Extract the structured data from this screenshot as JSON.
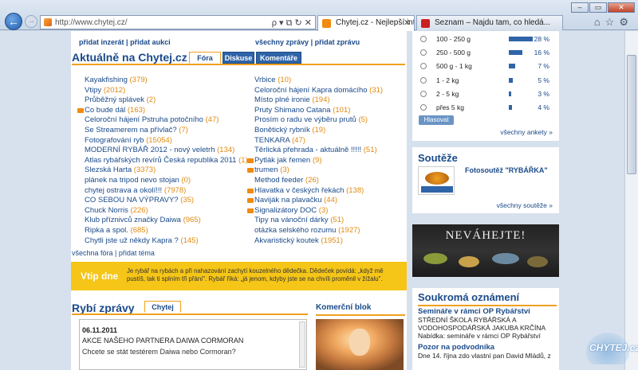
{
  "browser": {
    "url": "http://www.chytej.cz/",
    "tabs": [
      {
        "label": "Chytej.cz - Nejlepší internet...",
        "active": true,
        "icon_color": "#f08a10"
      },
      {
        "label": "Seznam – Najdu tam, co hledá...",
        "active": false,
        "icon_color": "#cc1e1e"
      }
    ],
    "addr_tools": "ρ ▾ ⧉ ↻ ✕",
    "window_buttons": {
      "min": "–",
      "max": "▭",
      "close": "✕"
    },
    "right_tools": "⌂☆⚙"
  },
  "header": {
    "add_ad": "přidat inzerát",
    "add_auction": "přidat aukci",
    "all_news": "všechny zprávy",
    "add_news": "přidat zprávu",
    "separator": "|"
  },
  "aktualne": {
    "title": "Aktuálně na Chytej.cz",
    "tabs": [
      "Fóra",
      "Diskuse",
      "Komentáře"
    ]
  },
  "forums_left": [
    {
      "name": "Kayakfishing",
      "count": "(379)",
      "new": false
    },
    {
      "name": "Vtipy",
      "count": "(2012)",
      "new": false
    },
    {
      "name": "Průběžný splávek",
      "count": "(2)",
      "new": false
    },
    {
      "name": "Co bude dál",
      "count": "(163)",
      "new": true
    },
    {
      "name": "Celoroční hájení Pstruha potočního",
      "count": "(47)",
      "new": false
    },
    {
      "name": "Se Streamerem na přívlač?",
      "count": "(7)",
      "new": false
    },
    {
      "name": "Fotografování ryb",
      "count": "(15054)",
      "new": false
    },
    {
      "name": "MODERNÍ RYBÁŘ 2012 - nový veletrh",
      "count": "(134)",
      "new": false
    },
    {
      "name": "Atlas rybářských revírů Česká republika 2011",
      "count": "(1)",
      "new": false
    },
    {
      "name": "Slezská Harta",
      "count": "(3373)",
      "new": false
    },
    {
      "name": "plánek na tripod nevo stojan",
      "count": "(0)",
      "new": false
    },
    {
      "name": "chytej ostrava a okolí!!!",
      "count": "(7978)",
      "new": false
    },
    {
      "name": "CO SEBOU NA VÝPRAVY?",
      "count": "(35)",
      "new": false
    },
    {
      "name": "Chuck Norris",
      "count": "(226)",
      "new": false
    },
    {
      "name": "Klub příznivců značky Daiwa",
      "count": "(965)",
      "new": false
    },
    {
      "name": "Ripka a spol.",
      "count": "(685)",
      "new": false
    },
    {
      "name": "Chytli jste už někdy Kapra ?",
      "count": "(145)",
      "new": false
    }
  ],
  "forums_right": [
    {
      "name": "Vrbice",
      "count": "(10)",
      "new": false
    },
    {
      "name": "Celoroční hájení Kapra domácího",
      "count": "(31)",
      "new": false
    },
    {
      "name": "Místo plné ironie",
      "count": "(194)",
      "new": false
    },
    {
      "name": "Pruty Shimano Catana",
      "count": "(101)",
      "new": false
    },
    {
      "name": "Prosím o radu ve výběru prutů",
      "count": "(5)",
      "new": false
    },
    {
      "name": "Bonětický rybník",
      "count": "(19)",
      "new": false
    },
    {
      "name": "TENKARA",
      "count": "(47)",
      "new": false
    },
    {
      "name": "Těrlická přehrada - aktuálně !!!!!",
      "count": "(51)",
      "new": false
    },
    {
      "name": "Pytlák jak řemen",
      "count": "(9)",
      "new": true
    },
    {
      "name": "trumen",
      "count": "(3)",
      "new": true
    },
    {
      "name": "Method feeder",
      "count": "(26)",
      "new": false
    },
    {
      "name": "Hlavatka v českých řekách",
      "count": "(138)",
      "new": true
    },
    {
      "name": "Naviják na plavačku",
      "count": "(44)",
      "new": true
    },
    {
      "name": "Signalizátory DOC",
      "count": "(3)",
      "new": true
    },
    {
      "name": "Tipy na vánoční dárky",
      "count": "(51)",
      "new": false
    },
    {
      "name": "otázka selského rozumu",
      "count": "(1927)",
      "new": false
    },
    {
      "name": "Akvaristický koutek",
      "count": "(1951)",
      "new": false
    }
  ],
  "forum_links": {
    "all": "všechna fóra",
    "add": "přidat téma"
  },
  "tip": {
    "label": "Vtip dne",
    "text": "Je rybář na rybách a při nahazování zachytí kouzelného dědečka. Dědeček povídá: „když mě pustíš, tak ti splním tři přání\". Rybář říká: „já jenom, kdyby jste se na chvíli proměnil v žížalu\"."
  },
  "rybi_zpravy": {
    "title": "Rybí zprávy",
    "tab": "Chytej",
    "date": "06.11.2011",
    "headline": "AKCE NAŠEHO PARTNERA DAIWA CORMORAN",
    "body": "Chcete se stát testérem Daiwa nebo Cormoran?"
  },
  "komercni": {
    "title": "Komerční blok"
  },
  "poll": {
    "rows": [
      {
        "label": "100 - 250 g",
        "pct": 28,
        "pct_text": "28 %"
      },
      {
        "label": "250 - 500 g",
        "pct": 16,
        "pct_text": "16 %"
      },
      {
        "label": "500 g - 1 kg",
        "pct": 7,
        "pct_text": "7 %"
      },
      {
        "label": "1 - 2 kg",
        "pct": 5,
        "pct_text": "5 %"
      },
      {
        "label": "2 - 5 kg",
        "pct": 3,
        "pct_text": "3 %"
      },
      {
        "label": "přes 5 kg",
        "pct": 4,
        "pct_text": "4 %"
      }
    ],
    "vote": "Hlasovat",
    "all": "všechny ankety »"
  },
  "soutez": {
    "title": "Soutěže",
    "item": "Fotosoutěž \"RYBÁŘKA\"",
    "all": "všechny soutěže »"
  },
  "banner": {
    "text": "NEVÁHEJTE!"
  },
  "oznameni": {
    "title": "Soukromá oznámení",
    "items": [
      {
        "head": "Semináře v rámci OP Rybářství",
        "l1": "STŘEDNÍ ŠKOLA RYBÁŘSKÁ A",
        "l2": "VODOHOSPODÁŘSKÁ JAKUBA KRČÍNA",
        "l3": "Nabídka: semináře v rámci OP Rybářství"
      },
      {
        "head": "Pozor na podvodníka",
        "l1": "Dne 14. října zdo vlastní pan David Mládů, z",
        "l2": "",
        "l3": ""
      }
    ]
  },
  "watermark": {
    "text": "CHYTEJ.cz"
  }
}
